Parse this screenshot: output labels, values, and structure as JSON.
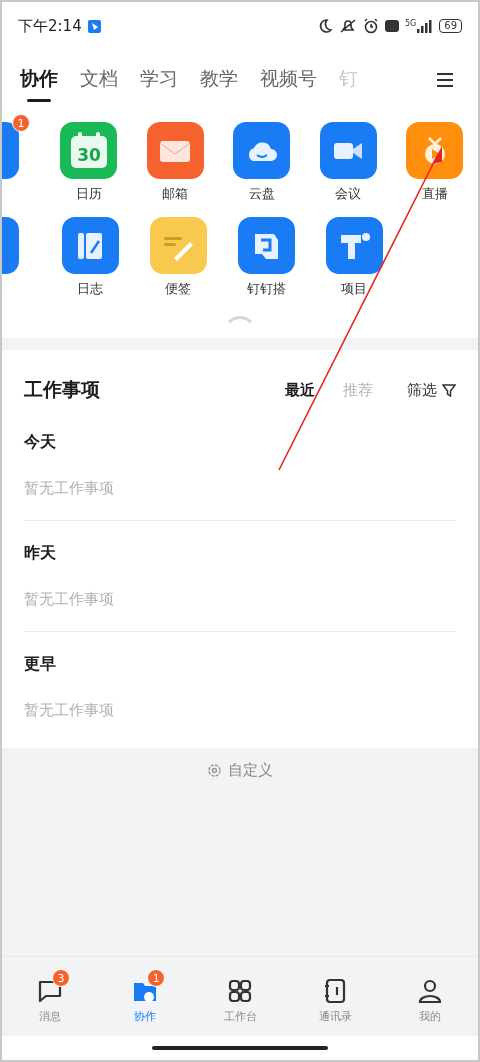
{
  "status_bar": {
    "time": "下午2:14",
    "network": "5G",
    "battery": "69"
  },
  "tabs": [
    {
      "label": "协作",
      "selected": true
    },
    {
      "label": "文档",
      "selected": false
    },
    {
      "label": "学习",
      "selected": false
    },
    {
      "label": "教学",
      "selected": false
    },
    {
      "label": "视频号",
      "selected": false
    },
    {
      "label": "钉",
      "selected": false
    }
  ],
  "apps": [
    [
      {
        "kind": "partial-box",
        "badge": "1"
      },
      {
        "kind": "calendar",
        "label": "日历",
        "day": "30"
      },
      {
        "kind": "mail",
        "label": "邮箱"
      },
      {
        "kind": "cloud",
        "label": "云盘"
      },
      {
        "kind": "video",
        "label": "会议"
      },
      {
        "kind": "live",
        "label": "直播"
      }
    ],
    [
      {
        "kind": "partial-compass"
      },
      {
        "kind": "log",
        "label": "日志"
      },
      {
        "kind": "note",
        "label": "便签"
      },
      {
        "kind": "builder",
        "label": "钉钉搭"
      },
      {
        "kind": "project",
        "label": "项目"
      }
    ]
  ],
  "work": {
    "title": "工作事项",
    "filters": [
      {
        "label": "最近",
        "selected": true
      },
      {
        "label": "推荐",
        "selected": false
      }
    ],
    "filter_button": "筛选",
    "groups": [
      {
        "title": "今天",
        "empty": "暂无工作事项"
      },
      {
        "title": "昨天",
        "empty": "暂无工作事项"
      },
      {
        "title": "更早",
        "empty": "暂无工作事项"
      }
    ]
  },
  "customize": "自定义",
  "bottom_nav": [
    {
      "kind": "chat",
      "label": "消息",
      "selected": false,
      "badge": "3"
    },
    {
      "kind": "collab",
      "label": "协作",
      "selected": true,
      "badge": "1"
    },
    {
      "kind": "grid",
      "label": "工作台",
      "selected": false
    },
    {
      "kind": "contacts",
      "label": "通讯录",
      "selected": false
    },
    {
      "kind": "person",
      "label": "我的",
      "selected": false
    }
  ]
}
